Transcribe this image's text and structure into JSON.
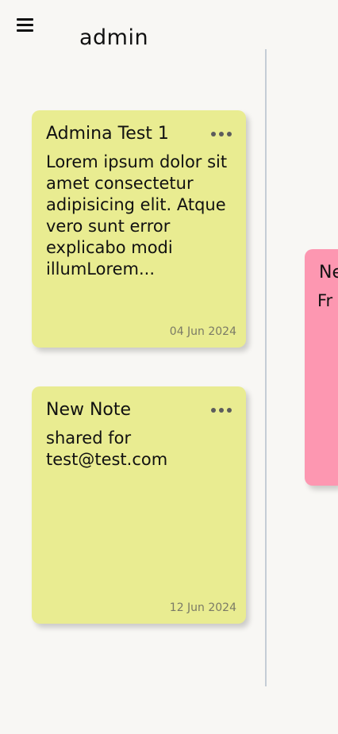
{
  "header": {
    "username": "admin"
  },
  "notes": [
    {
      "title": "Admina Test 1",
      "body": "Lorem ipsum dolor sit amet consectetur adipisicing elit. Atque vero sunt error explicabo modi illumLorem...",
      "date": "04 Jun 2024",
      "color": "#e9ec91"
    },
    {
      "title": "New Note",
      "body": "shared for test@test.com",
      "date": "12 Jun 2024",
      "color": "#e9ec91"
    }
  ],
  "partial_note": {
    "title": "Ne",
    "body": "Fr",
    "color": "#fd97b1"
  },
  "icons": {
    "menu": "hamburger-menu-icon",
    "more": "more-options-icon"
  }
}
